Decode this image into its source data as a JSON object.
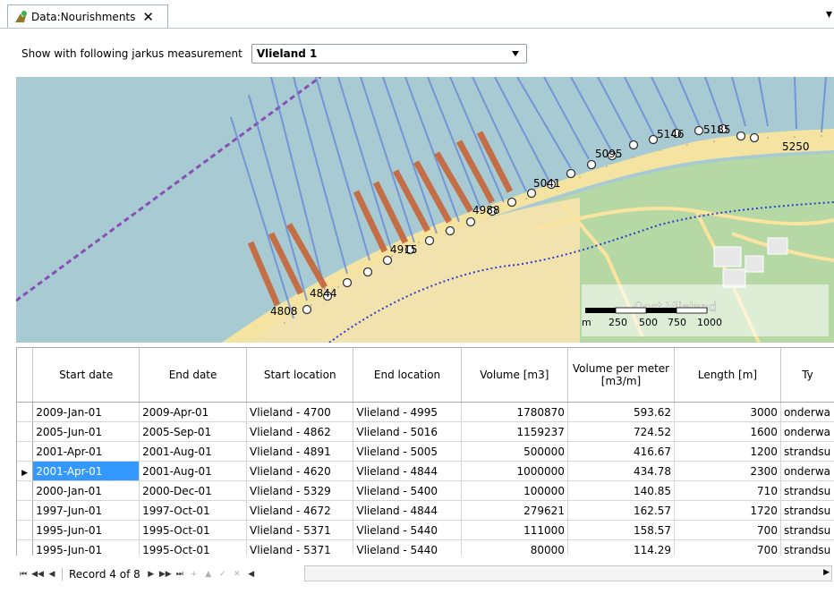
{
  "tab": {
    "title": "Data:Nourishments",
    "close": "✕",
    "icon": "nourishment-icon"
  },
  "pin": "📌",
  "filter": {
    "label": "Show with following jarkus measurement",
    "selected": "Vlieland 1"
  },
  "map": {
    "transect_labels": [
      "4808",
      "4844",
      "4915",
      "4988",
      "5041",
      "5095",
      "5146",
      "5185",
      "5250"
    ],
    "place_label": "Oost-Vlieland",
    "scale": {
      "unit": "m",
      "ticks": [
        "250",
        "500",
        "750",
        "1000"
      ]
    },
    "colors": {
      "sea": "#a8cbd3",
      "land": "#b5d8a5",
      "beach": "#f5e4a1",
      "road": "#fbe3a0",
      "transect": "#5e7fd8",
      "nourishment": "#c8653a",
      "boundary": "#8a4db8"
    }
  },
  "table": {
    "columns": [
      "Start date",
      "End date",
      "Start location",
      "End location",
      "Volume [m3]",
      "Volume per meter [m3/m]",
      "Length [m]",
      "Ty"
    ],
    "rows": [
      [
        "2009-Jan-01",
        "2009-Apr-01",
        "Vlieland - 4700",
        "Vlieland - 4995",
        "1780870",
        "593.62",
        "3000",
        "onderwa"
      ],
      [
        "2005-Jun-01",
        "2005-Sep-01",
        "Vlieland - 4862",
        "Vlieland - 5016",
        "1159237",
        "724.52",
        "1600",
        "onderwa"
      ],
      [
        "2001-Apr-01",
        "2001-Aug-01",
        "Vlieland - 4891",
        "Vlieland - 5005",
        "500000",
        "416.67",
        "1200",
        "strandsu"
      ],
      [
        "2001-Apr-01",
        "2001-Aug-01",
        "Vlieland - 4620",
        "Vlieland - 4844",
        "1000000",
        "434.78",
        "2300",
        "onderwa"
      ],
      [
        "2000-Jan-01",
        "2000-Dec-01",
        "Vlieland - 5329",
        "Vlieland - 5400",
        "100000",
        "140.85",
        "710",
        "strandsu"
      ],
      [
        "1997-Jun-01",
        "1997-Oct-01",
        "Vlieland - 4672",
        "Vlieland - 4844",
        "279621",
        "162.57",
        "1720",
        "strandsu"
      ],
      [
        "1995-Jun-01",
        "1995-Oct-01",
        "Vlieland - 5371",
        "Vlieland - 5440",
        "111000",
        "158.57",
        "700",
        "strandsu"
      ],
      [
        "1995-Jun-01",
        "1995-Oct-01",
        "Vlieland - 5371",
        "Vlieland - 5440",
        "80000",
        "114.29",
        "700",
        "strandsu"
      ]
    ],
    "selected_row": 3
  },
  "navigator": {
    "record_text": "Record 4 of 8"
  }
}
